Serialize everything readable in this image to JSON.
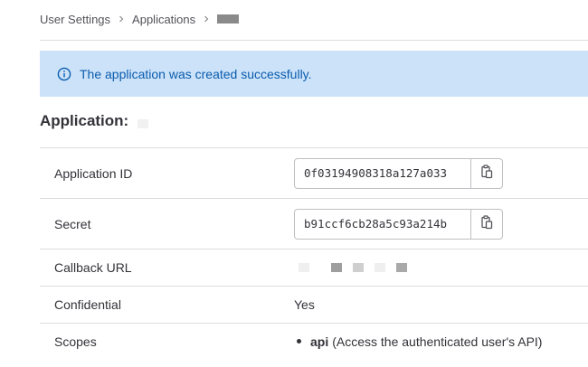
{
  "breadcrumb": {
    "items": [
      "User Settings",
      "Applications"
    ]
  },
  "alert": {
    "message": "The application was created successfully."
  },
  "application": {
    "heading": "Application:"
  },
  "details": {
    "app_id_label": "Application ID",
    "app_id_value": "0f03194908318a127a033",
    "secret_label": "Secret",
    "secret_value": "b91ccf6cb28a5c93a214b",
    "callback_label": "Callback URL",
    "confidential_label": "Confidential",
    "confidential_value": "Yes",
    "scopes_label": "Scopes",
    "scopes": [
      {
        "name": "api",
        "description": "(Access the authenticated user's API)"
      }
    ]
  },
  "colors": {
    "alert_bg": "#cbe2f9",
    "alert_text": "#0b5cad",
    "border": "#dcdcde"
  },
  "icons": {
    "alert": "info-circle-icon",
    "copy": "clipboard-icon",
    "separator": "chevron-right-icon"
  }
}
